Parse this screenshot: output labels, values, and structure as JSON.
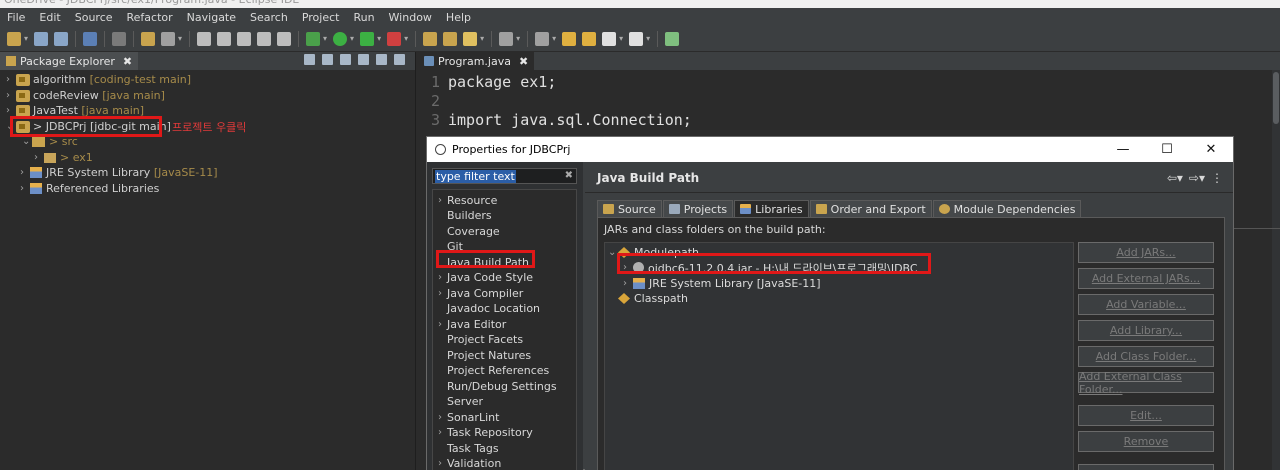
{
  "window": {
    "title": "OneDrive - JDBCPrj/src/ex1/Program.java - Eclipse IDE"
  },
  "menu": [
    "File",
    "Edit",
    "Source",
    "Refactor",
    "Navigate",
    "Search",
    "Project",
    "Run",
    "Window",
    "Help"
  ],
  "package_explorer": {
    "tab_label": "Package Explorer",
    "close": "✖",
    "projects": [
      {
        "name": "algorithm",
        "decoration": "[coding-test main]"
      },
      {
        "name": "codeReview",
        "decoration": "[java main]"
      },
      {
        "name": "JavaTest",
        "decoration": "[java main]"
      },
      {
        "name": "> JDBCPrj [jdbc-git main]",
        "decoration": ""
      }
    ],
    "src": "> src",
    "package": "> ex1",
    "jre": {
      "name": "JRE System Library",
      "decoration": "[JavaSE-11]"
    },
    "ref_libs": "Referenced Libraries",
    "annotation": "프로젝트 우클릭"
  },
  "editor": {
    "tab_label": "Program.java",
    "close": "✖",
    "lines": [
      {
        "num": "1",
        "text": "package ex1;"
      },
      {
        "num": "2",
        "text": ""
      },
      {
        "num": "3",
        "text": "import java.sql.Connection;"
      }
    ]
  },
  "dialog": {
    "title": "Properties for JDBCPrj",
    "minimize": "—",
    "maximize": "☐",
    "close": "✕",
    "filter_text": "type filter text",
    "filter_clear": "✖",
    "nav": [
      {
        "label": "Resource",
        "expandable": true
      },
      {
        "label": "Builders",
        "expandable": false
      },
      {
        "label": "Coverage",
        "expandable": false
      },
      {
        "label": "Git",
        "expandable": false
      },
      {
        "label": "Java Build Path",
        "expandable": false
      },
      {
        "label": "Java Code Style",
        "expandable": true
      },
      {
        "label": "Java Compiler",
        "expandable": true
      },
      {
        "label": "Javadoc Location",
        "expandable": false
      },
      {
        "label": "Java Editor",
        "expandable": true
      },
      {
        "label": "Project Facets",
        "expandable": false
      },
      {
        "label": "Project Natures",
        "expandable": false
      },
      {
        "label": "Project References",
        "expandable": false
      },
      {
        "label": "Run/Debug Settings",
        "expandable": false
      },
      {
        "label": "Server",
        "expandable": false
      },
      {
        "label": "SonarLint",
        "expandable": true
      },
      {
        "label": "Task Repository",
        "expandable": true
      },
      {
        "label": "Task Tags",
        "expandable": false
      },
      {
        "label": "Validation",
        "expandable": true
      }
    ],
    "section_title": "Java Build Path",
    "tabs": [
      "Source",
      "Projects",
      "Libraries",
      "Order and Export",
      "Module Dependencies"
    ],
    "active_tab": "Libraries",
    "jars_label": "JARs and class folders on the build path:",
    "tree": {
      "modulepath": "Modulepath",
      "jar": "ojdbc6-11.2.0.4.jar - H:\\내 드라이브\\프로그래밍\\JDBC",
      "jre": "JRE System Library [JavaSE-11]",
      "classpath": "Classpath"
    },
    "buttons": [
      "Add JARs...",
      "Add External JARs...",
      "Add Variable...",
      "Add Library...",
      "Add Class Folder...",
      "Add External Class Folder...",
      "Edit...",
      "Remove",
      ""
    ]
  },
  "colors": {
    "highlight": "#e01818",
    "selection": "#2b5ea7"
  }
}
